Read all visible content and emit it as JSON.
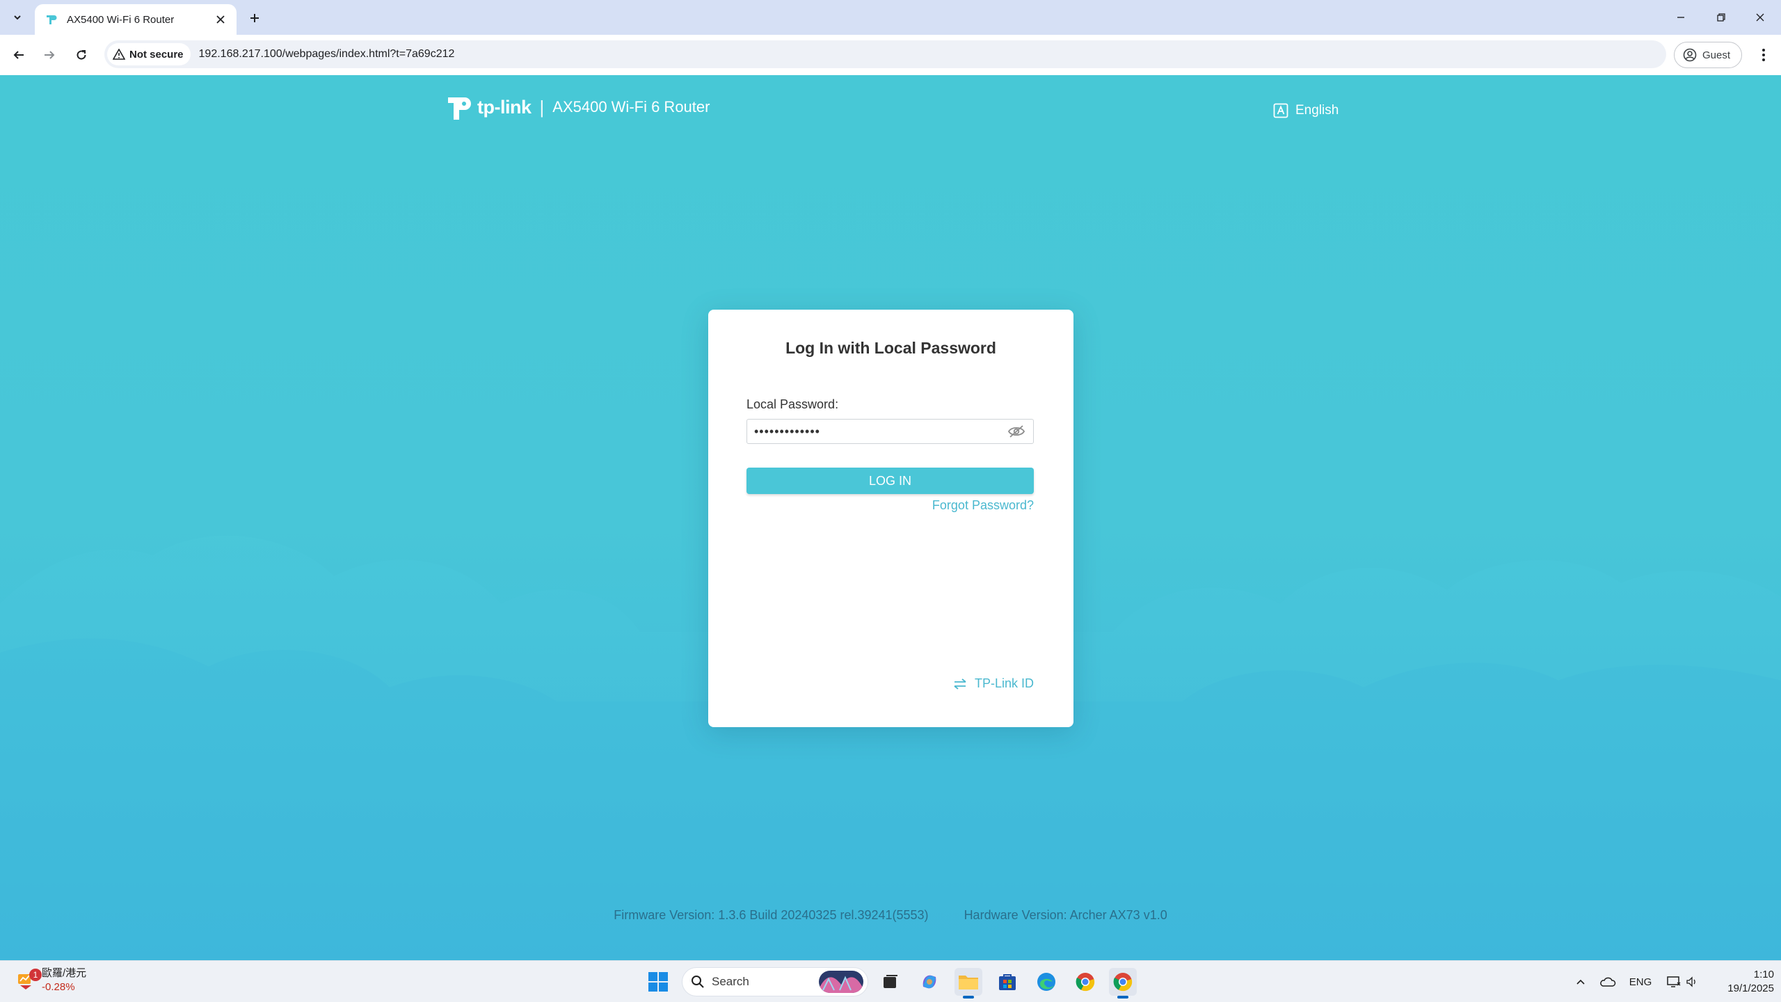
{
  "browser": {
    "tab_title": "AX5400 Wi-Fi 6 Router",
    "security_label": "Not secure",
    "url": "192.168.217.100/webpages/index.html?t=7a69c212",
    "profile_label": "Guest"
  },
  "header": {
    "logo_text": "tp-link",
    "model": "AX5400 Wi-Fi 6 Router",
    "language": "English"
  },
  "login": {
    "title": "Log In with Local Password",
    "password_label": "Local Password:",
    "password_value": "•••••••••••••",
    "login_button": "LOG IN",
    "forgot_link": "Forgot Password?",
    "tplink_id_link": "TP-Link ID"
  },
  "footer": {
    "firmware": "Firmware Version: 1.3.6 Build 20240325 rel.39241(5553)",
    "hardware": "Hardware Version: Archer AX73 v1.0"
  },
  "taskbar": {
    "widget_badge": "1",
    "widget_title": "歐羅/港元",
    "widget_value": "-0.28%",
    "search_placeholder": "Search",
    "tray_lang": "ENG",
    "time": "1:10",
    "date": "19/1/2025"
  },
  "colors": {
    "page_bg": "#47c8d6",
    "accent": "#4ac6d7",
    "link": "#4ab8cf"
  }
}
